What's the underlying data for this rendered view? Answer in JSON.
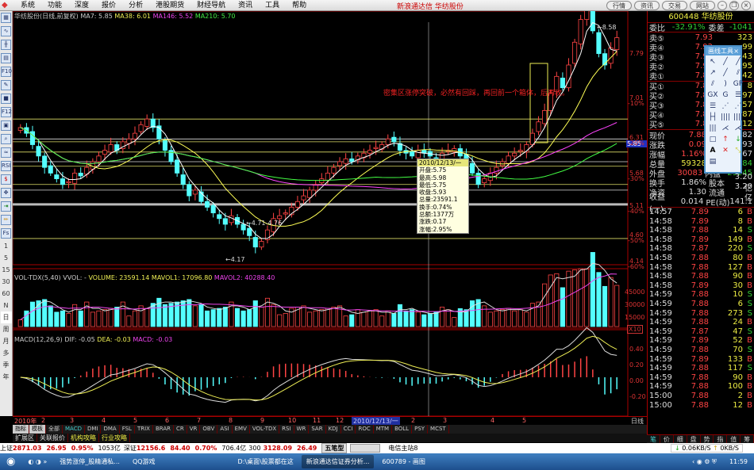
{
  "menu": {
    "items": [
      "系统",
      "功能",
      "深度",
      "报价",
      "分析",
      "港股期货",
      "财经导航",
      "资讯",
      "工具",
      "帮助"
    ]
  },
  "window_title": "新浪通达信 华纺股份",
  "nav_buttons": [
    "行情",
    "资讯",
    "交易",
    "网站"
  ],
  "price_header": {
    "name": "华纺股份(日线,前复权)",
    "ma7": "MA7: 5.85",
    "ma38": "MA38: 6.01",
    "ma146": "MA146: 5.52",
    "ma210": "MA210: 5.70"
  },
  "vol_header": {
    "name": "VOL-TDX(5,40) VVOL: -",
    "volume": "VOLUME: 23591.14",
    "mavol1": "MAVOL1: 17096.80",
    "mavol2": "MAVOL2: 40288.40"
  },
  "macd_header": {
    "name": "MACD(12,26,9)",
    "dif": "DIF: -0.05",
    "dea": "DEA: -0.03",
    "macd": "MACD: -0.03"
  },
  "annotation": "密集区涨停突破，必然有回踩，再回前一个箱体，后再攻。",
  "chart_labels": {
    "high": "8.58",
    "low": "4.17",
    "range": "4.71-4.76",
    "current_price_tag": "5.85",
    "x10": "X10"
  },
  "price_axis": [
    [
      "7.79",
      ""
    ],
    [
      "7.01",
      "-10%"
    ],
    [
      "6.31",
      "-20%"
    ],
    [
      "5.68",
      "-30%"
    ],
    [
      "5.11",
      "-40%"
    ],
    [
      "4.60",
      "-50%"
    ],
    [
      "4.14",
      "-60%"
    ]
  ],
  "vol_axis": [
    "45000",
    "30000",
    "15000"
  ],
  "macd_axis": [
    "0.40",
    "0.20",
    "0.00",
    "-0.20"
  ],
  "colors": {
    "up": "#ff4444",
    "down": "#54ffff",
    "ma7": "#ffffff",
    "ma38": "#ffff55",
    "ma146": "#ff44ff",
    "ma210": "#44ff44"
  },
  "chart_data": {
    "type": "candlestick",
    "closes": [
      6.3,
      6.2,
      6.0,
      5.8,
      5.6,
      5.5,
      5.4,
      5.3,
      5.35,
      5.5,
      5.45,
      5.6,
      5.7,
      5.8,
      5.9,
      6.0,
      5.9,
      6.05,
      6.1,
      6.2,
      6.35,
      6.45,
      6.3,
      6.1,
      5.9,
      5.7,
      5.5,
      5.3,
      5.1,
      5.2,
      5.0,
      4.9,
      4.8,
      4.7,
      4.6,
      4.75,
      4.6,
      4.5,
      4.4,
      4.2,
      4.3,
      4.5,
      4.7,
      4.75,
      4.8,
      4.9,
      5.0,
      5.1,
      5.2,
      5.3,
      5.4,
      5.5,
      5.6,
      5.7,
      5.75,
      5.7,
      5.8,
      5.85,
      5.9,
      5.95,
      6.0,
      6.1,
      6.05,
      5.9,
      5.85,
      5.8,
      5.9,
      5.85,
      5.8,
      5.75,
      5.85,
      5.9,
      5.93,
      5.8,
      5.7,
      5.5,
      5.3,
      5.4,
      5.5,
      5.6,
      5.7,
      5.8,
      5.85,
      5.9,
      6.0,
      6.2,
      6.4,
      6.6,
      6.9,
      7.2,
      7.0,
      7.4,
      7.8,
      8.2,
      8.58,
      8.0,
      7.6,
      7.4,
      7.7,
      7.88
    ],
    "drawn_levels": [
      6.45,
      6.1,
      6.05,
      5.87,
      5.7,
      5.62,
      5.3,
      5.2,
      4.95,
      4.35
    ],
    "ylim": [
      4.14,
      7.79
    ]
  },
  "tooltip": {
    "date": "2010/12/13/一",
    "lines": [
      "开盘:5.75",
      "最高:5.98",
      "最低:5.75",
      "收盘:5.93",
      "总量:23591.1",
      "换手:0.74%",
      "总额:1377万",
      "涨跌:0.17",
      "涨幅:2.95%"
    ]
  },
  "date_axis": {
    "labels": [
      "2010年",
      "2",
      "3",
      "4",
      "5",
      "6",
      "7",
      "8",
      "9",
      "10",
      "11",
      "12",
      "2010/12/13/一",
      "2",
      "3",
      "4",
      "5"
    ],
    "period": "日线"
  },
  "left_toolbar": {
    "periods": [
      "1",
      "5",
      "15",
      "30",
      "60",
      "N",
      "日",
      "周",
      "月",
      "多",
      "季",
      "年"
    ]
  },
  "index_tabs": [
    "指标",
    "模板",
    "全部",
    "MACD",
    "DMI",
    "DMA",
    "FSL",
    "TRIX",
    "BRAR",
    "CR",
    "VR",
    "OBV",
    "ASI",
    "EMV",
    "VOL-TDX",
    "RSI",
    "WR",
    "SAR",
    "KDJ",
    "CCI",
    "ROC",
    "MTM",
    "BOLL",
    "PSY",
    "MCST"
  ],
  "ext_tabs": [
    "扩展区",
    "关联报价",
    "机构攻略",
    "行业攻略"
  ],
  "quote": {
    "code": "600448",
    "name": "华纺股份",
    "webi_label": "委比",
    "webi": "-32.91%",
    "weicha_label": "委差",
    "weicha": "-1041",
    "asks": [
      [
        "卖⑤",
        "7.93",
        "323"
      ],
      [
        "卖④",
        "7.92",
        "99"
      ],
      [
        "卖③",
        "7.91",
        "43"
      ],
      [
        "卖②",
        "7.90",
        "95"
      ],
      [
        "卖①",
        "7.89",
        "42"
      ]
    ],
    "bids": [
      [
        "买①",
        "7.88",
        "8"
      ],
      [
        "买②",
        "7.87",
        "97"
      ],
      [
        "买③",
        "7.86",
        "57"
      ],
      [
        "买④",
        "7.85",
        "87"
      ],
      [
        "买⑤",
        "7.84",
        "12"
      ]
    ],
    "stats": [
      [
        "现价",
        "7.88",
        "今开",
        "7.82"
      ],
      [
        "涨跌",
        "0.09",
        "最高",
        "7.93"
      ],
      [
        "涨幅",
        "1.16%",
        "最低",
        "7.67"
      ],
      [
        "总量",
        "59328",
        "量比",
        "0.84"
      ],
      [
        "外盘",
        "30083",
        "内盘",
        "29245"
      ],
      [
        "换手",
        "1.86%",
        "股本",
        "3.20亿"
      ],
      [
        "净资",
        "1.30",
        "流通",
        "3.20亿"
      ],
      [
        "收益(一)",
        "0.014",
        "PE(动)",
        "141.1"
      ]
    ]
  },
  "ticks": [
    [
      "14:57",
      "7.89",
      "6",
      "B"
    ],
    [
      "14:58",
      "7.89",
      "8",
      "B"
    ],
    [
      "14:58",
      "7.88",
      "14",
      "S"
    ],
    [
      "14:58",
      "7.89",
      "149",
      "B"
    ],
    [
      "14:58",
      "7.87",
      "220",
      "S"
    ],
    [
      "14:58",
      "7.88",
      "80",
      "B"
    ],
    [
      "14:58",
      "7.88",
      "127",
      "B"
    ],
    [
      "14:58",
      "7.88",
      "90",
      "B"
    ],
    [
      "14:58",
      "7.89",
      "30",
      "B"
    ],
    [
      "14:59",
      "7.88",
      "10",
      "S"
    ],
    [
      "14:59",
      "7.88",
      "6",
      "S"
    ],
    [
      "14:59",
      "7.88",
      "273",
      "S"
    ],
    [
      "14:59",
      "7.88",
      "24",
      "B"
    ],
    [
      "14:59",
      "7.87",
      "47",
      "S"
    ],
    [
      "14:59",
      "7.89",
      "52",
      "B"
    ],
    [
      "14:59",
      "7.88",
      "70",
      "S"
    ],
    [
      "14:59",
      "7.89",
      "133",
      "B"
    ],
    [
      "14:59",
      "7.88",
      "117",
      "S"
    ],
    [
      "14:59",
      "7.88",
      "90",
      "B"
    ],
    [
      "14:59",
      "7.88",
      "100",
      "B"
    ],
    [
      "15:00",
      "7.88",
      "2",
      "B"
    ],
    [
      "15:00",
      "7.88",
      "12",
      "B"
    ]
  ],
  "right_tabs": [
    "笔",
    "价",
    "细",
    "盘",
    "势",
    "指",
    "值",
    "筹"
  ],
  "drawtool": {
    "title": "画线工具"
  },
  "status": {
    "sh": [
      "上证",
      "2871.03",
      "26.95",
      "0.95%",
      "1053亿"
    ],
    "sz": [
      "深证",
      "12156.6",
      "84.40",
      "0.70%",
      "706.4亿"
    ],
    "hs300": [
      "300",
      "3128.09",
      "26.49"
    ],
    "ime": "五笔型",
    "server": "电信主站8",
    "down": "0.06KB/S",
    "up": "0KB/S"
  },
  "taskbar": {
    "items": [
      "强势涨停_股精通私...",
      "QQ游戏",
      "D:\\桌面\\股票都在这",
      "新浪通达信证券分析...",
      "600789 - 画图"
    ],
    "clock": "11:59"
  }
}
